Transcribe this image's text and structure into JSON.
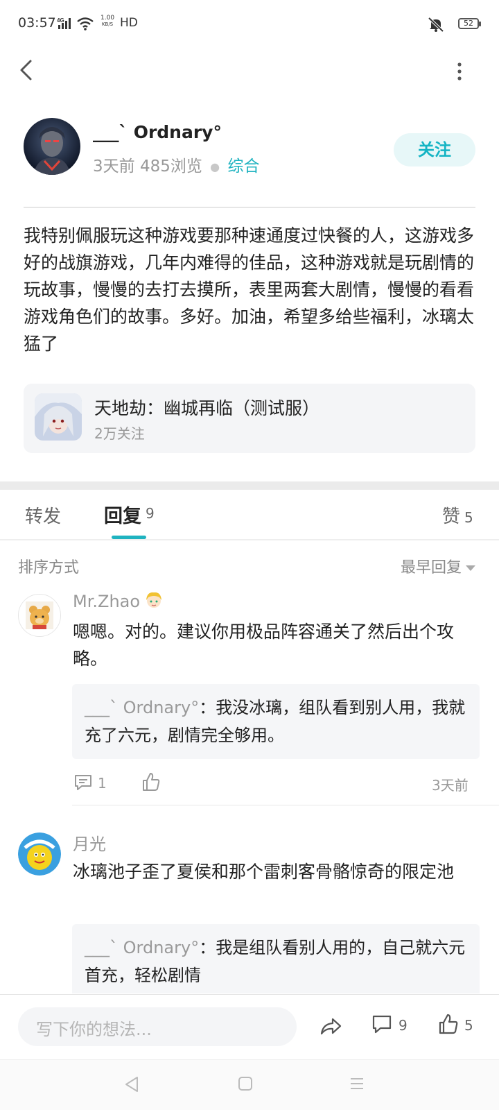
{
  "status_bar": {
    "time": "03:57",
    "network": "4G",
    "speed_value": "1.00",
    "speed_unit": "KB/S",
    "hd": "HD",
    "battery": "52"
  },
  "author": {
    "name": "___ˋ Ordnary°",
    "time_ago": "3天前",
    "views": "485浏览",
    "category": "综合",
    "follow_label": "关注"
  },
  "post": {
    "body": "我特别佩服玩这种游戏要那种速通度过快餐的人，这游戏多好的战旗游戏，几年内难得的佳品，这种游戏就是玩剧情的玩故事，慢慢的去打去摸所，表里两套大剧情，慢慢的看看游戏角色们的故事。多好。加油，希望多给些福利，冰璃太猛了"
  },
  "game_card": {
    "title": "天地劫：幽城再临（测试服）",
    "followers": "2万关注"
  },
  "tabs": {
    "forward": "转发",
    "replies": "回复",
    "replies_count": "9",
    "likes": "赞",
    "likes_count": "5"
  },
  "sort": {
    "label": "排序方式",
    "value": "最早回复"
  },
  "comments": [
    {
      "name": "Mr.Zhao",
      "text": "嗯嗯。对的。建议你用极品阵容通关了然后出个攻略。",
      "quote_name": "___ˋ Ordnary°",
      "quote_text": "我没冰璃，组队看到别人用，我就充了六元，剧情完全够用。",
      "reply_count": "1",
      "time": "3天前"
    },
    {
      "name": "月光",
      "text": "冰璃池子歪了夏侯和那个雷刺客骨骼惊奇的限定池",
      "quote_name": "___ˋ Ordnary°",
      "quote_text": "我是组队看别人用的，自己就六元首充，轻松剧情"
    }
  ],
  "bottom_bar": {
    "input_placeholder": "写下你的想法...",
    "comment_count": "9",
    "like_count": "5"
  },
  "colors": {
    "accent": "#1fb3c0",
    "follow_bg": "#e7f7f8"
  }
}
